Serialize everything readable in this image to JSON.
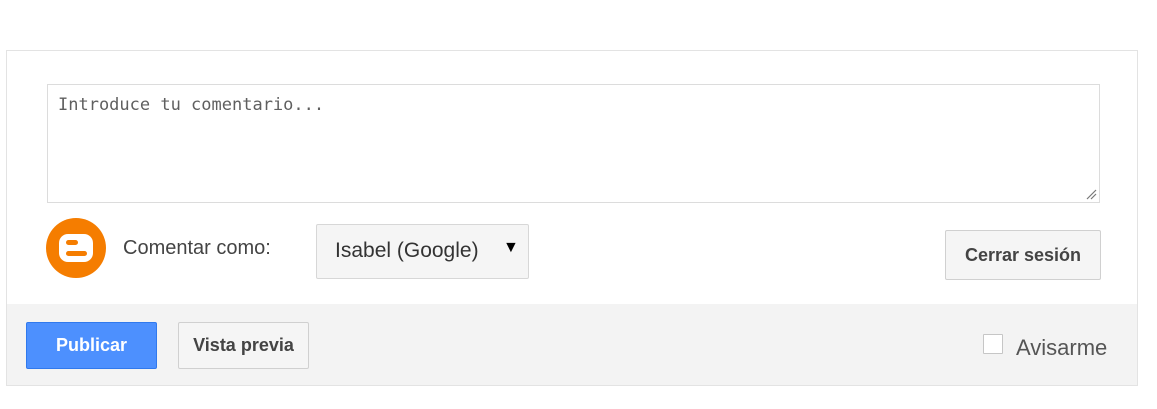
{
  "comment": {
    "placeholder": "Introduce tu comentario...",
    "value": ""
  },
  "identity": {
    "label": "Comentar como:",
    "selected_account": "Isabel (Google)",
    "logout_label": "Cerrar sesión"
  },
  "footer": {
    "publish_label": "Publicar",
    "preview_label": "Vista previa",
    "notify_label": "Avisarme",
    "notify_checked": false
  },
  "colors": {
    "publish_button": "#4d90fe",
    "blogger_orange": "#f57d00",
    "footer_bg": "#f3f3f3"
  },
  "icons": {
    "blogger": "blogger-logo-icon",
    "dropdown": "triangle-down-icon",
    "resize": "resize-grip-icon"
  }
}
